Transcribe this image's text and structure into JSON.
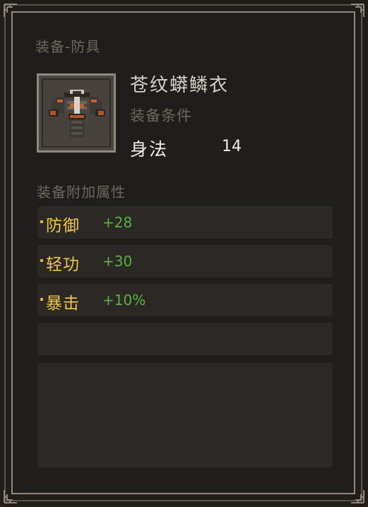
{
  "tooltip": {
    "category": "装备-防具",
    "item_name": "苍纹蟒鳞衣",
    "requirement_title": "装备条件",
    "requirement": {
      "attribute": "身法",
      "value": "14"
    },
    "bonus_title": "装备附加属性",
    "bonuses": [
      {
        "label": "防御",
        "value": "+28"
      },
      {
        "label": "轻功",
        "value": "+30"
      },
      {
        "label": "暴击",
        "value": "+10%"
      }
    ],
    "empty_row": "",
    "description": ""
  },
  "icon": {
    "name": "armor-robe-icon"
  },
  "colors": {
    "label_gold": "#f0c64a",
    "value_green": "#58b23c",
    "muted_text": "#6c665d",
    "frame": "#8d877c"
  }
}
